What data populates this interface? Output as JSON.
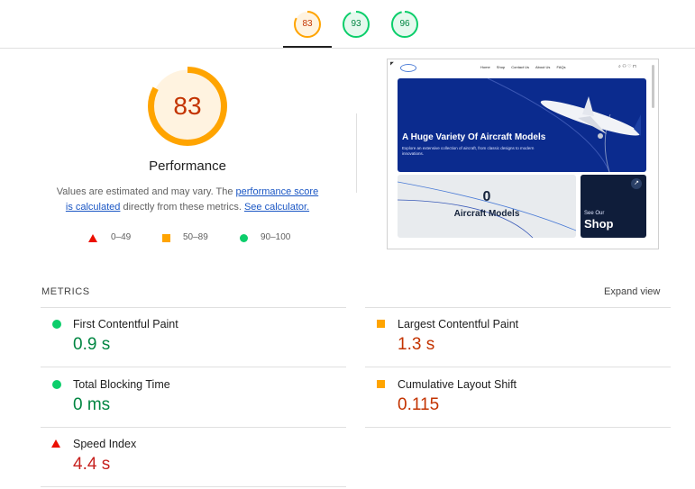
{
  "score_tabs": [
    {
      "score": "83",
      "color": "#ffa400",
      "text_color": "#c33300",
      "fraction": 0.83
    },
    {
      "score": "93",
      "color": "#0cce6b",
      "text_color": "#018642",
      "fraction": 0.93
    },
    {
      "score": "96",
      "color": "#0cce6b",
      "text_color": "#018642",
      "fraction": 0.96
    }
  ],
  "performance": {
    "score": "83",
    "fraction": 0.83,
    "gauge_color": "#ffa400",
    "gauge_bg": "#fff3e0",
    "title": "Performance",
    "desc_pre": "Values are estimated and may vary. The ",
    "desc_link1": "performance score is calculated",
    "desc_mid": " directly from these metrics. ",
    "desc_link2": "See calculator."
  },
  "legend": {
    "fail_range": "0–49",
    "average_range": "50–89",
    "pass_range": "90–100"
  },
  "preview": {
    "nav_links": [
      "Home",
      "Shop",
      "Contact Us",
      "About Us",
      "FAQs"
    ],
    "hero_title": "A Huge Variety Of Aircraft Models",
    "hero_sub": "Explore an extensive collection of aircraft, from classic designs to modern innovations.",
    "counter_value": "0",
    "counter_label": "Aircraft Models",
    "shop_pre": "See Our",
    "shop_label": "Shop",
    "shop_arrow": "↗"
  },
  "metrics": {
    "title": "METRICS",
    "expand_label": "Expand view",
    "items": [
      {
        "label": "First Contentful Paint",
        "value": "0.9 s",
        "rating": "pass"
      },
      {
        "label": "Largest Contentful Paint",
        "value": "1.3 s",
        "rating": "average"
      },
      {
        "label": "Total Blocking Time",
        "value": "0 ms",
        "rating": "pass"
      },
      {
        "label": "Cumulative Layout Shift",
        "value": "0.115",
        "rating": "average"
      },
      {
        "label": "Speed Index",
        "value": "4.4 s",
        "rating": "fail"
      }
    ]
  },
  "colors": {
    "pass": "#0cce6b",
    "average": "#ffa400",
    "fail": "#eb0f00",
    "pass_text": "#018642",
    "average_text": "#c33300",
    "fail_text": "#c7221f",
    "link": "#1a56c4"
  }
}
